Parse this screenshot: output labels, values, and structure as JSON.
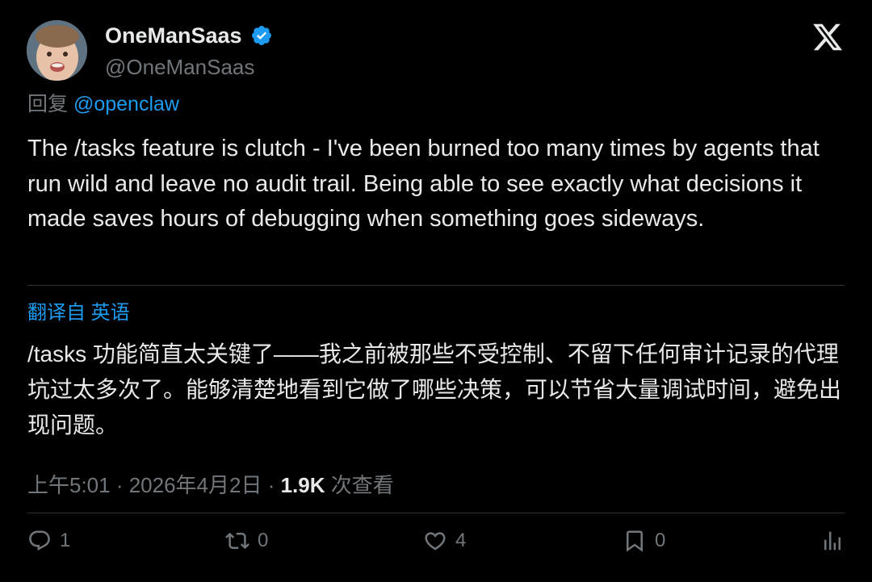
{
  "author": {
    "display_name": "OneManSaas",
    "handle": "@OneManSaas",
    "verified": true,
    "avatar_icon": "toddler-avatar"
  },
  "brand": {
    "logo_icon": "x-logo-icon"
  },
  "reply": {
    "prefix": "回复",
    "mention": "@openclaw"
  },
  "tweet": {
    "text": "The /tasks feature is clutch - I've been burned too many times by agents that run wild and leave no audit trail. Being able to see exactly what decisions it made saves hours of debugging when something goes sideways."
  },
  "translation": {
    "label": "翻译自 英语",
    "text": "/tasks 功能简直太关键了——我之前被那些不受控制、不留下任何审计记录的代理坑过太多次了。能够清楚地看到它做了哪些决策，可以节省大量调试时间，避免出现问题。"
  },
  "meta": {
    "time_date": "上午5:01 · 2026年4月2日 · ",
    "views_count": "1.9K",
    "views_label": " 次查看"
  },
  "actions": {
    "replies": "1",
    "reposts": "0",
    "likes": "4",
    "bookmarks": "0"
  },
  "colors": {
    "background": "#000000",
    "text": "#e7e9ea",
    "secondary": "#71767b",
    "accent": "#1d9bf0",
    "divider": "#2f3336"
  }
}
